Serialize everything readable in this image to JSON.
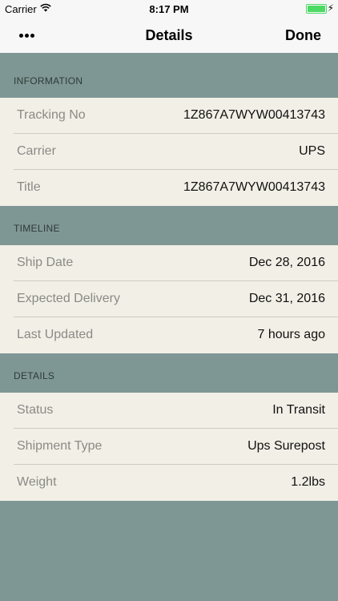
{
  "status_bar": {
    "carrier": "Carrier",
    "time": "8:17 PM",
    "wifi_icon": "wifi-icon",
    "battery_icon": "battery-icon",
    "battery_level": 1.0,
    "charging_icon": "bolt-icon"
  },
  "nav": {
    "more_icon": "more-icon",
    "title": "Details",
    "done_label": "Done"
  },
  "colors": {
    "background": "#7f9794",
    "row_background": "#f2efe6",
    "header_text": "#2e3a38",
    "label_text": "#8a8a86",
    "battery": "#4cd964"
  },
  "sections": [
    {
      "header": "INFORMATION",
      "rows": [
        {
          "label": "Tracking No",
          "value": "1Z867A7WYW00413743"
        },
        {
          "label": "Carrier",
          "value": "UPS"
        },
        {
          "label": "Title",
          "value": "1Z867A7WYW00413743"
        }
      ]
    },
    {
      "header": "TIMELINE",
      "rows": [
        {
          "label": "Ship Date",
          "value": "Dec 28, 2016"
        },
        {
          "label": "Expected Delivery",
          "value": "Dec 31, 2016"
        },
        {
          "label": "Last Updated",
          "value": "7 hours ago"
        }
      ]
    },
    {
      "header": "DETAILS",
      "rows": [
        {
          "label": "Status",
          "value": "In Transit"
        },
        {
          "label": "Shipment Type",
          "value": "Ups Surepost"
        },
        {
          "label": "Weight",
          "value": "1.2lbs"
        }
      ]
    }
  ]
}
